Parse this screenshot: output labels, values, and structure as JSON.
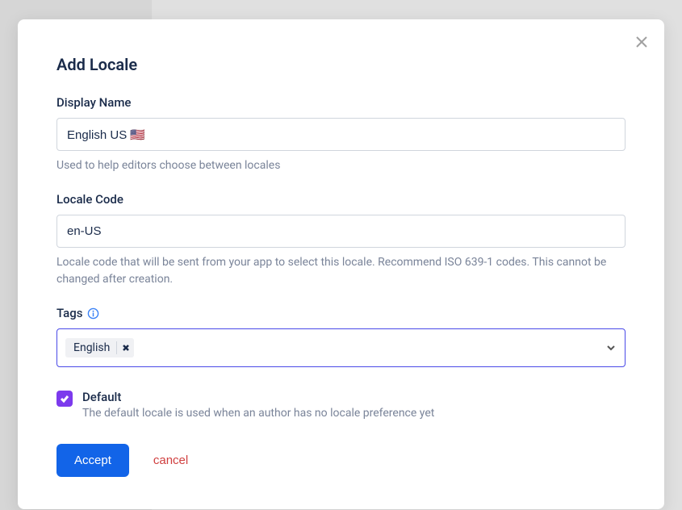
{
  "modal": {
    "title": "Add Locale",
    "displayName": {
      "label": "Display Name",
      "value": "English US 🇺🇸",
      "help": "Used to help editors choose between locales"
    },
    "localeCode": {
      "label": "Locale Code",
      "value": "en-US",
      "help": "Locale code that will be sent from your app to select this locale. Recommend ISO 639-1 codes. This cannot be changed after creation."
    },
    "tags": {
      "label": "Tags",
      "values": [
        "English"
      ]
    },
    "defaultCheckbox": {
      "label": "Default",
      "help": "The default locale is used when an author has no locale preference yet",
      "checked": true
    },
    "buttons": {
      "accept": "Accept",
      "cancel": "cancel"
    }
  }
}
